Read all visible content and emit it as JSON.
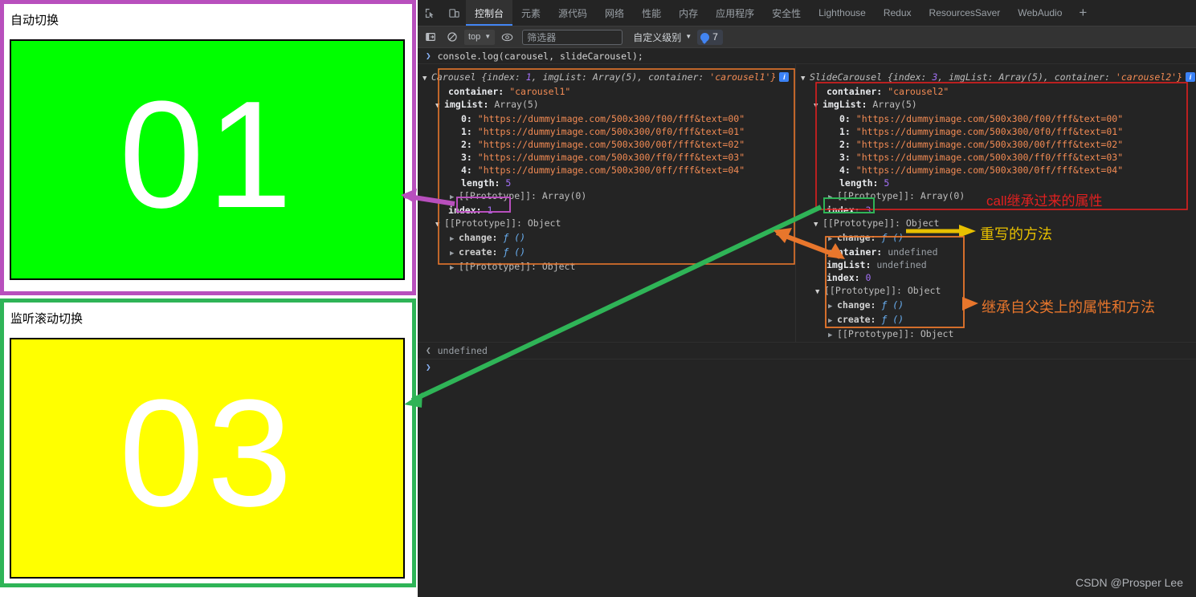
{
  "page": {
    "demos": [
      {
        "title": "自动切换",
        "label": "01",
        "bg": "#00ff00",
        "border": "#b84fbd"
      },
      {
        "title": "监听滚动切换",
        "label": "03",
        "bg": "#ffff00",
        "border": "#2fb457"
      }
    ]
  },
  "devtools": {
    "tabs": [
      {
        "label": "控制台",
        "active": true
      },
      {
        "label": "元素",
        "active": false
      },
      {
        "label": "源代码",
        "active": false
      },
      {
        "label": "网络",
        "active": false
      },
      {
        "label": "性能",
        "active": false
      },
      {
        "label": "内存",
        "active": false
      },
      {
        "label": "应用程序",
        "active": false
      },
      {
        "label": "安全性",
        "active": false
      },
      {
        "label": "Lighthouse",
        "active": false
      },
      {
        "label": "Redux",
        "active": false
      },
      {
        "label": "ResourcesSaver",
        "active": false
      },
      {
        "label": "WebAudio",
        "active": false
      }
    ],
    "add_tab_label": "+",
    "toolbar": {
      "context_value": "top",
      "filter_placeholder": "筛选器",
      "filter_value": "",
      "level_label": "自定义级别",
      "issues_count": "7"
    },
    "console": {
      "command": "console.log(carousel, slideCarousel);",
      "command_fn": "console",
      "command_method": "log",
      "command_args": "(carousel, slideCarousel);",
      "result": "undefined",
      "prompt": ">",
      "left_object": {
        "class_name": "Carousel",
        "summary_index_key": "index:",
        "summary_index_value": "1",
        "summary_imglist": "imgList:",
        "summary_imglist_value": "Array(5),",
        "summary_container": "container:",
        "summary_container_value": "'carousel1'}",
        "container_key": "container:",
        "container_value": "\"carousel1\"",
        "imglist_key": "imgList:",
        "imglist_type": "Array(5)",
        "items": [
          {
            "idx": "0:",
            "url": "\"https://dummyimage.com/500x300/f00/fff&text=00\""
          },
          {
            "idx": "1:",
            "url": "\"https://dummyimage.com/500x300/0f0/fff&text=01\""
          },
          {
            "idx": "2:",
            "url": "\"https://dummyimage.com/500x300/00f/fff&text=02\""
          },
          {
            "idx": "3:",
            "url": "\"https://dummyimage.com/500x300/ff0/fff&text=03\""
          },
          {
            "idx": "4:",
            "url": "\"https://dummyimage.com/500x300/0ff/fff&text=04\""
          }
        ],
        "length_key": "length:",
        "length_value": "5",
        "proto_array": "[[Prototype]]: Array(0)",
        "index_key": "index:",
        "index_value": "1",
        "proto_object": "[[Prototype]]: Object",
        "change_key": "change:",
        "create_key": "create:",
        "fn_glyph": "ƒ ()",
        "proto_object_2": "[[Prototype]]: Object"
      },
      "right_object": {
        "class_name": "SlideCarousel",
        "summary_index_key": "index:",
        "summary_index_value": "3",
        "summary_imglist": "imgList:",
        "summary_imglist_value": "Array(5),",
        "summary_container": "container:",
        "summary_container_value": "'carousel2'}",
        "container_key": "container:",
        "container_value": "\"carousel2\"",
        "imglist_key": "imgList:",
        "imglist_type": "Array(5)",
        "items": [
          {
            "idx": "0:",
            "url": "\"https://dummyimage.com/500x300/f00/fff&text=00\""
          },
          {
            "idx": "1:",
            "url": "\"https://dummyimage.com/500x300/0f0/fff&text=01\""
          },
          {
            "idx": "2:",
            "url": "\"https://dummyimage.com/500x300/00f/fff&text=02\""
          },
          {
            "idx": "3:",
            "url": "\"https://dummyimage.com/500x300/ff0/fff&text=03\""
          },
          {
            "idx": "4:",
            "url": "\"https://dummyimage.com/500x300/0ff/fff&text=04\""
          }
        ],
        "length_key": "length:",
        "length_value": "5",
        "proto_array": "[[Prototype]]: Array(0)",
        "index_key": "index:",
        "index_value": "3",
        "proto_object": "[[Prototype]]: Object",
        "change_key": "change:",
        "fn_glyph": "ƒ ()",
        "inner_container_key": "container:",
        "inner_container_value": "undefined",
        "inner_imglist_key": "imgList:",
        "inner_imglist_value": "undefined",
        "inner_index_key": "index:",
        "inner_index_value": "0",
        "inner_proto_object": "[[Prototype]]: Object",
        "inner_change_key": "change:",
        "inner_create_key": "create:",
        "inner_proto_object_2": "[[Prototype]]: Object"
      }
    }
  },
  "annotations": {
    "call_inherit": "call继承过来的属性",
    "overridden_method": "重写的方法",
    "inherited_from_parent": "继承自父类上的属性和方法"
  },
  "watermark": "CSDN @Prosper Lee",
  "colors": {
    "magenta": "#b84fbd",
    "green": "#2fb457",
    "orange": "#e8762c",
    "red": "#e02020",
    "yellow": "#e8c000",
    "accent_blue": "#4285f4"
  }
}
